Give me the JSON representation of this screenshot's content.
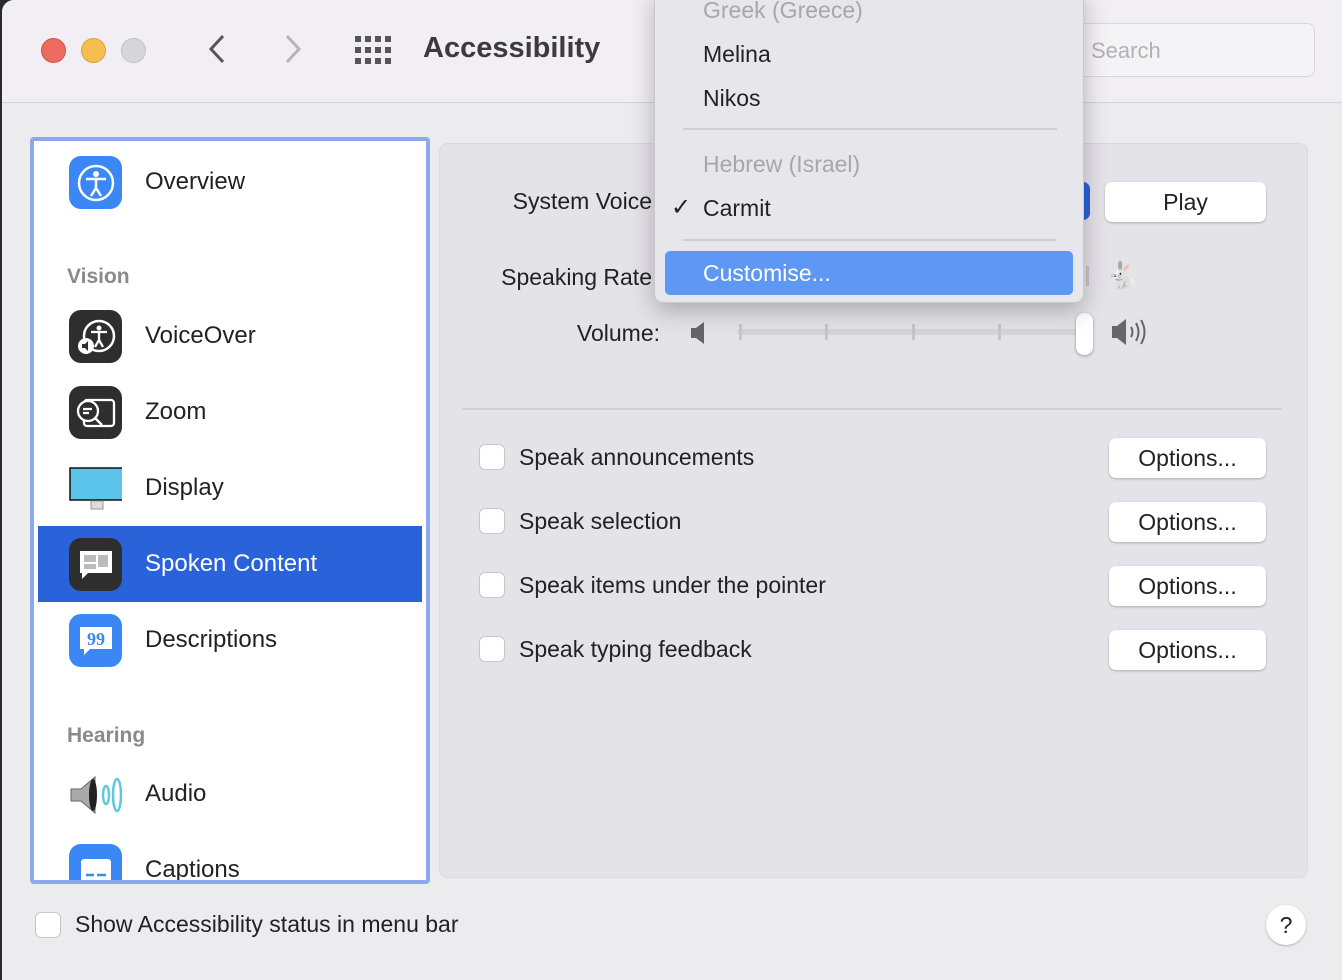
{
  "window": {
    "title": "Accessibility",
    "search_placeholder": "Search"
  },
  "sidebar": {
    "items": [
      {
        "label": "Overview",
        "icon": "accessibility-icon"
      },
      {
        "label": "VoiceOver",
        "icon": "voiceover-icon"
      },
      {
        "label": "Zoom",
        "icon": "zoom-icon"
      },
      {
        "label": "Display",
        "icon": "display-icon"
      },
      {
        "label": "Spoken Content",
        "icon": "spoken-content-icon",
        "selected": true
      },
      {
        "label": "Descriptions",
        "icon": "descriptions-icon"
      },
      {
        "label": "Audio",
        "icon": "audio-icon"
      },
      {
        "label": "Captions",
        "icon": "captions-icon"
      }
    ],
    "sections": {
      "vision": "Vision",
      "hearing": "Hearing"
    }
  },
  "content": {
    "system_voice_label": "System Voice",
    "play_label": "Play",
    "speaking_rate_label": "Speaking Rate",
    "volume_label": "Volume:",
    "volume_level": 1.0,
    "options": [
      {
        "label": "Speak announcements",
        "checked": false,
        "button": "Options..."
      },
      {
        "label": "Speak selection",
        "checked": false,
        "button": "Options..."
      },
      {
        "label": "Speak items under the pointer",
        "checked": false,
        "button": "Options..."
      },
      {
        "label": "Speak typing feedback",
        "checked": false,
        "button": "Options..."
      }
    ]
  },
  "menu": {
    "items": [
      {
        "label": "Greek (Greece)",
        "type": "header"
      },
      {
        "label": "Melina"
      },
      {
        "label": "Nikos"
      },
      {
        "label": "Hebrew (Israel)",
        "type": "header"
      },
      {
        "label": "Carmit",
        "checked": true
      },
      {
        "label": "Customise...",
        "highlighted": true
      }
    ],
    "checkmark": "✓"
  },
  "footer": {
    "status_label": "Show Accessibility status in menu bar",
    "help": "?"
  },
  "colors": {
    "accent": "#2962d9",
    "highlight": "#5f97f5",
    "sidebar_border": "#8ca8ef"
  }
}
